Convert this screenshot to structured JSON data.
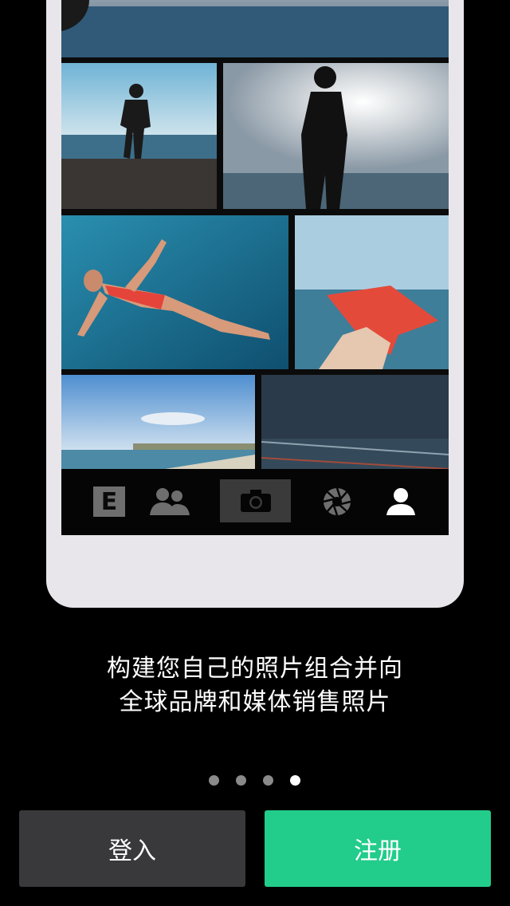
{
  "caption": {
    "line1": "构建您自己的照片组合并向",
    "line2": "全球品牌和媒体销售照片"
  },
  "tabbar": {
    "items": [
      {
        "name": "editorial",
        "icon": "e-logo-icon",
        "active": false
      },
      {
        "name": "community",
        "icon": "people-icon",
        "active": false
      },
      {
        "name": "camera",
        "icon": "camera-icon",
        "active": true
      },
      {
        "name": "missions",
        "icon": "aperture-icon",
        "active": false
      },
      {
        "name": "profile",
        "icon": "person-icon",
        "active": false
      }
    ],
    "e_letter": "E"
  },
  "pagination": {
    "count": 4,
    "active_index": 3
  },
  "buttons": {
    "login": "登入",
    "register": "注册"
  },
  "colors": {
    "register_green": "#22cc8a",
    "login_gray": "#39383b",
    "frame": "#e8e6ea"
  }
}
